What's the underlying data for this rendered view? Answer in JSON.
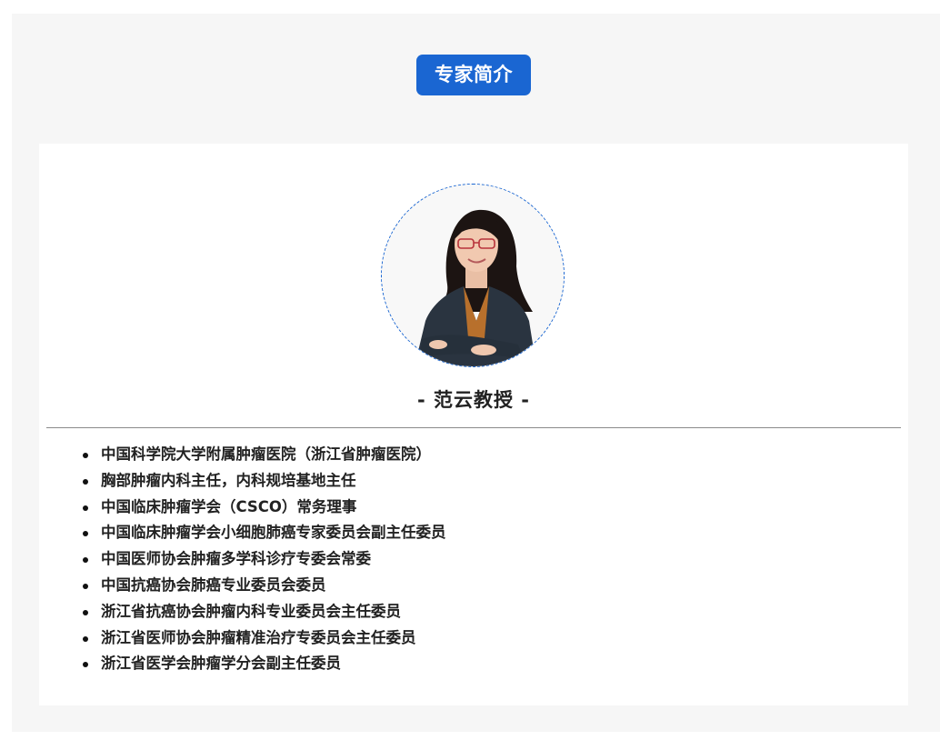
{
  "header": {
    "title": "专家简介"
  },
  "profile": {
    "name": "- 范云教授 -",
    "credentials": [
      "中国科学院大学附属肿瘤医院（浙江省肿瘤医院）",
      "胸部肿瘤内科主任，内科规培基地主任",
      "中国临床肿瘤学会（CSCO）常务理事",
      "中国临床肿瘤学会小细胞肺癌专家委员会副主任委员",
      "中国医师协会肿瘤多学科诊疗专委会常委",
      "中国抗癌协会肺癌专业委员会委员",
      "浙江省抗癌协会肿瘤内科专业委员会主任委员",
      "浙江省医师协会肿瘤精准治疗专委员会主任委员",
      "浙江省医学会肿瘤学分会副主任委员"
    ]
  },
  "colors": {
    "accent": "#1a66d2",
    "background": "#f6f6f6",
    "card": "#ffffff",
    "text": "#222222"
  }
}
